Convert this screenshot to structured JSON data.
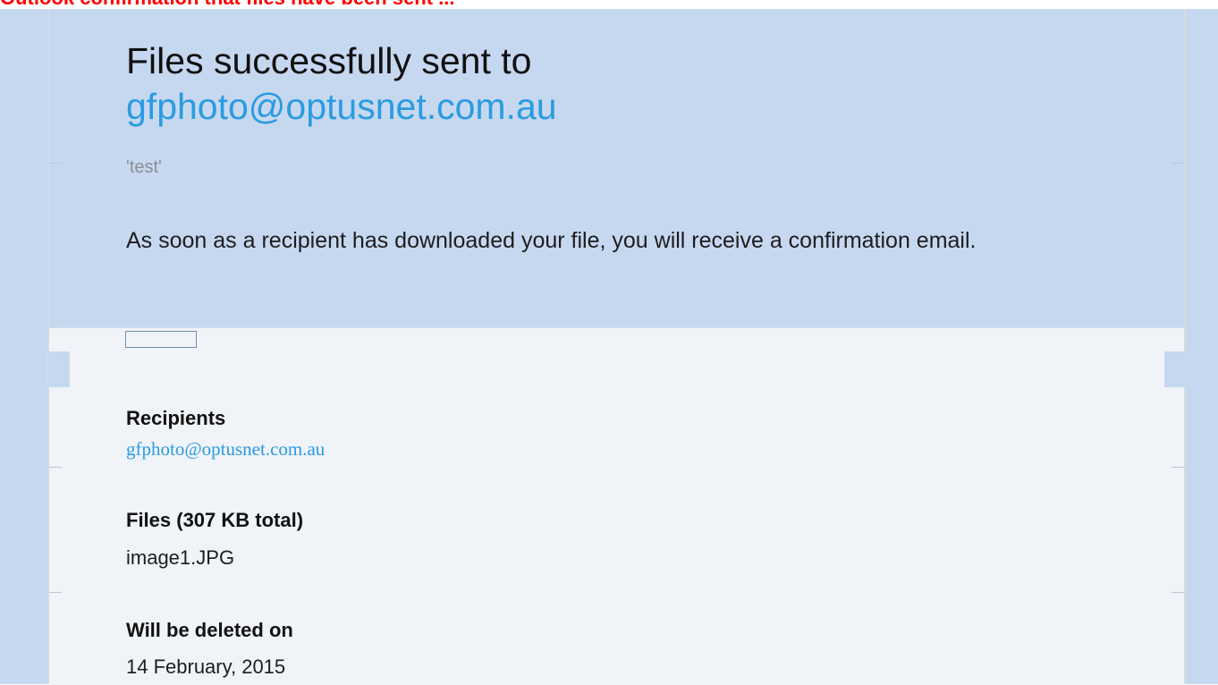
{
  "caption": "Outlook confirmation that files have been sent ...",
  "header": {
    "title_prefix": "Files successfully sent to",
    "title_email": "gfphoto@optusnet.com.au",
    "message_title": "'test'",
    "confirmation_text": "As soon as a recipient has downloaded your file, you will receive a confirmation email."
  },
  "details": {
    "recipients_label": "Recipients",
    "recipients_value": "gfphoto@optusnet.com.au",
    "files_label": "Files (307 KB total)",
    "files_value": "image1.JPG",
    "deletion_label": "Will be deleted on",
    "deletion_value": "14 February, 2015"
  },
  "colors": {
    "caption": "#ff0000",
    "header_bg": "#c6d8f0",
    "body_bg": "#f0f3f7",
    "link": "#2a9be0"
  }
}
